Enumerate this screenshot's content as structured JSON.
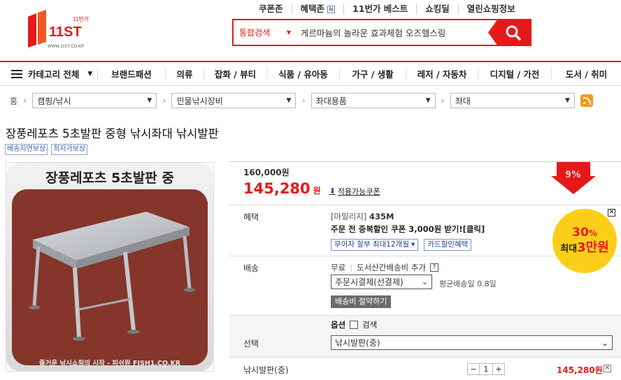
{
  "header": {
    "logo_text": "11ST",
    "logo_sub": "WWW.11ST.CO.KR",
    "logo_corner": "11번가",
    "top_links": [
      "쿠폰존",
      "혜택존",
      "11번가 베스트",
      "쇼킹딜",
      "열린쇼핑정보"
    ],
    "benefit_badge": "N",
    "search": {
      "scope": "통합검색",
      "query": "게르마늄의 놀라운 효과체험 오즈헬스링"
    }
  },
  "nav": {
    "all_categories": "카테고리 전체",
    "items": [
      "브랜드패션",
      "의류",
      "잡화 / 뷰티",
      "식품 / 유아동",
      "가구 / 생활",
      "레저 / 자동차",
      "디지털 / 가전",
      "도서 / 취미"
    ]
  },
  "breadcrumb": {
    "home": "홈",
    "levels": [
      "캠핑/낚시",
      "민물낚시장비",
      "좌대용품",
      "좌대"
    ]
  },
  "product": {
    "title": "장풍레포츠 5초발판 중형 낚시좌대 낚시발판",
    "tags": [
      "배송지연보상",
      "최저가보상"
    ],
    "image_caption_top": "장풍레포츠 5초발판 중",
    "image_caption_bottom": "즐거운 낚시쇼핑의 시작 - 피쉬원 FISH1.CO.KR",
    "original_price": "160,000원",
    "sale_price": "145,280",
    "sale_unit": "원",
    "coupon_link": "적용가능쿠폰",
    "discount": "9%",
    "benefit": {
      "label": "혜택",
      "mileage_label": "[마일리지]",
      "mileage_value": "435M",
      "coupon_text": "주문 전 중복할인 쿠폰 3,000원 받기![클릭]",
      "installment_btn": "무이자 할부 최대12개월",
      "card_btn": "카드할인혜택"
    },
    "promo_badge": {
      "top": "30",
      "top_unit": "%",
      "bottom_prefix": "최대",
      "bottom_value": "3만원"
    },
    "shipping": {
      "label": "배송",
      "free": "무료",
      "extra": "도서산간배송비 추가",
      "help": "?",
      "method": "주문시결제(선결제)",
      "avg": "평균배송일 0.8일",
      "save_btn": "배송비 절약하기"
    },
    "option": {
      "label": "선택",
      "header": "옵션",
      "search_label": "검색",
      "selected": "낚시발판(중)"
    },
    "line_item": {
      "name": "낚시발판(중)",
      "qty": "1",
      "minus": "−",
      "plus": "+",
      "price": "145,280원"
    }
  },
  "colors": {
    "brand_red": "#e5191a",
    "badge_yellow": "#fbcf19",
    "link_blue": "#1d43a0"
  }
}
